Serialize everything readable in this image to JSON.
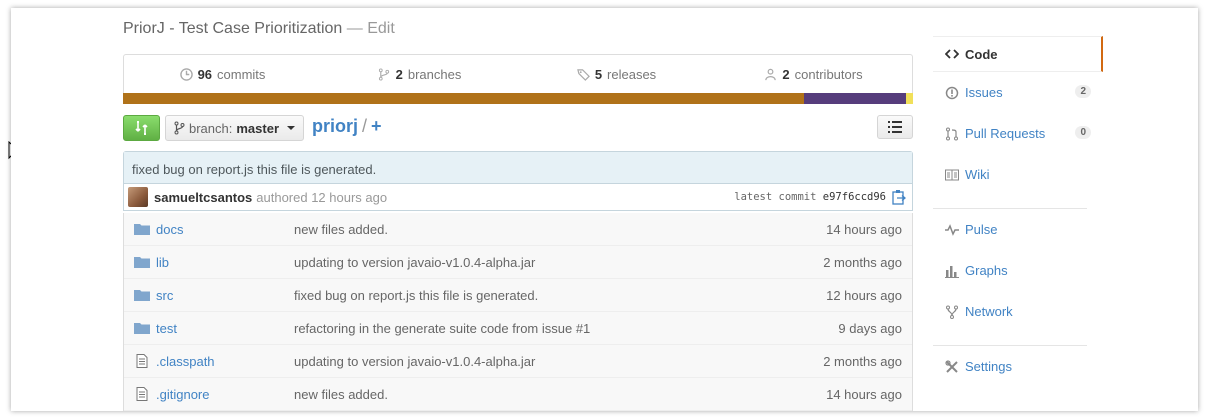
{
  "repo": {
    "description": "PriorJ - Test Case Prioritization",
    "separator": "—",
    "edit_label": "Edit"
  },
  "stats": {
    "commits_count": "96",
    "commits_label": "commits",
    "branches_count": "2",
    "branches_label": "branches",
    "releases_count": "5",
    "releases_label": "releases",
    "contributors_count": "2",
    "contributors_label": "contributors"
  },
  "languages": [
    {
      "color": "#b07219",
      "fraction": 0.862
    },
    {
      "color": "#563d7c",
      "fraction": 0.129
    },
    {
      "color": "#f1e05a",
      "fraction": 0.009
    }
  ],
  "toolbar": {
    "branch_label": "branch:",
    "branch_name": "master",
    "repo_name": "priorj",
    "path_sep": "/",
    "add_label": "+"
  },
  "commit": {
    "message": "fixed bug on report.js this file is generated.",
    "author": "samueltcsantos",
    "authored": "authored 12 hours ago",
    "latest_label": "latest commit",
    "sha": "e97f6ccd96"
  },
  "files": [
    {
      "type": "folder",
      "name": "docs",
      "message": "new files added.",
      "age": "14 hours ago"
    },
    {
      "type": "folder",
      "name": "lib",
      "message": "updating to version javaio-v1.0.4-alpha.jar",
      "age": "2 months ago"
    },
    {
      "type": "folder",
      "name": "src",
      "message": "fixed bug on report.js this file is generated.",
      "age": "12 hours ago"
    },
    {
      "type": "folder",
      "name": "test",
      "message": "refactoring in the generate suite code from issue #1",
      "age": "9 days ago"
    },
    {
      "type": "file",
      "name": ".classpath",
      "message": "updating to version javaio-v1.0.4-alpha.jar",
      "age": "2 months ago"
    },
    {
      "type": "file",
      "name": ".gitignore",
      "message": "new files added.",
      "age": "14 hours ago"
    }
  ],
  "nav": {
    "code": "Code",
    "issues": "Issues",
    "issues_count": "2",
    "pulls": "Pull Requests",
    "pulls_count": "0",
    "wiki": "Wiki",
    "pulse": "Pulse",
    "graphs": "Graphs",
    "network": "Network",
    "settings": "Settings"
  },
  "colors": {
    "link": "#4183c4",
    "accent_selected": "#d26911",
    "green_button": "#60b044"
  }
}
